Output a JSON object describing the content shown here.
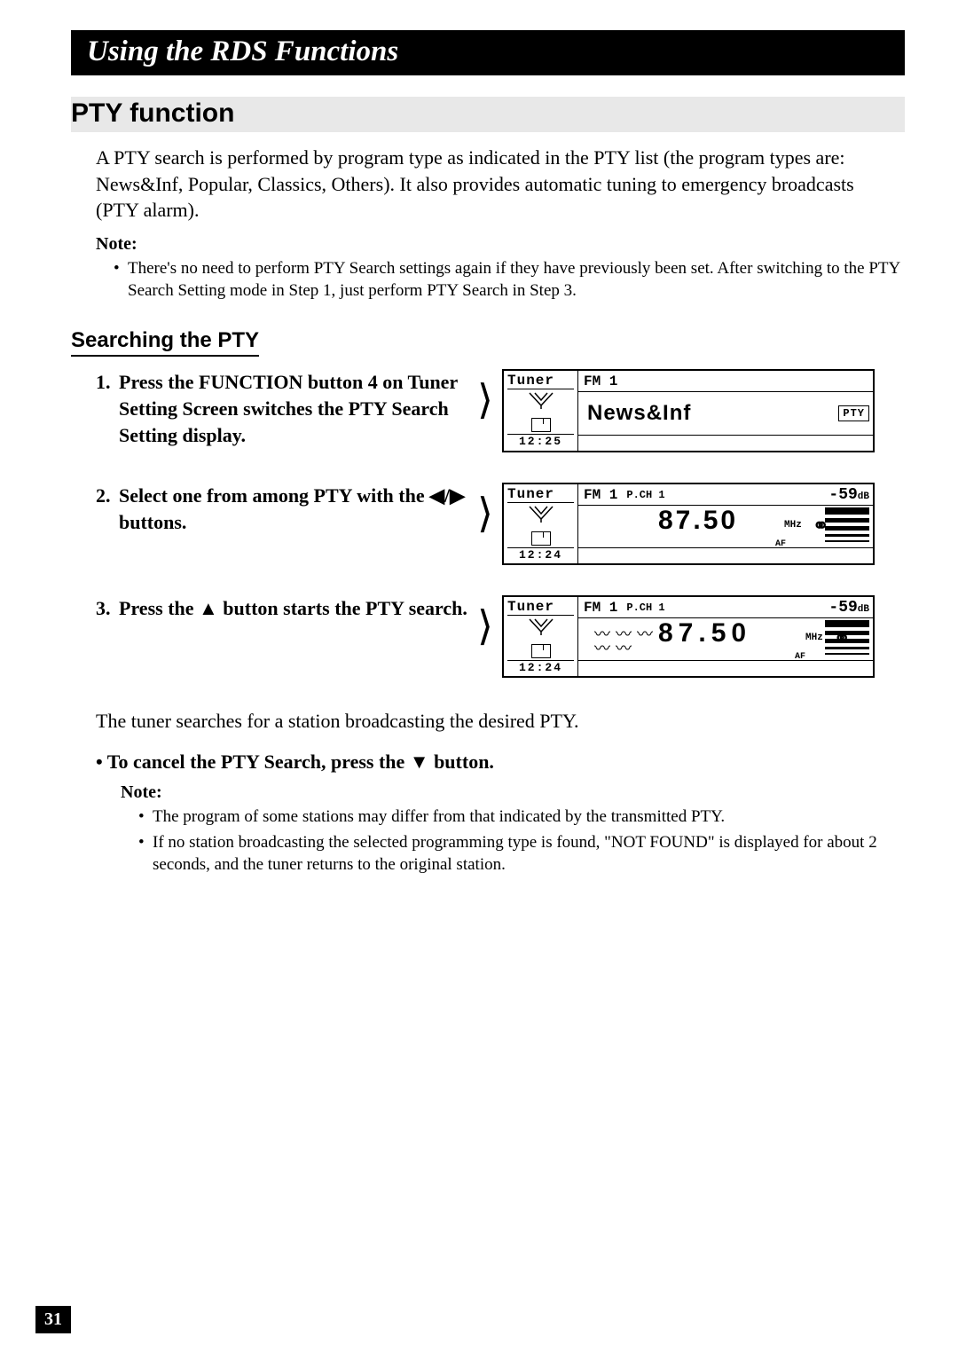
{
  "title": "Using the RDS Functions",
  "section_heading": "PTY function",
  "intro": "A PTY search is performed by program type as indicated in the PTY list (the program types are: News&Inf, Popular, Classics, Others). It also provides automatic tuning to emergency broadcasts (PTY alarm).",
  "note_label": "Note:",
  "note_top_bullets": [
    "There's no need to perform PTY Search settings again if they have previously been set. After switching to the PTY Search Setting mode in Step 1, just perform PTY Search in Step 3."
  ],
  "subheading": "Searching the PTY",
  "steps": [
    {
      "num": "1.",
      "text": "Press the FUNCTION button 4 on Tuner Setting Screen switches the PTY Search Setting display."
    },
    {
      "num": "2.",
      "text": "Select one from among PTY with the ◀/▶ buttons."
    },
    {
      "num": "3.",
      "text": "Press the ▲ button starts the PTY search."
    }
  ],
  "lcd": {
    "tuner": "Tuner",
    "fm": "FM 1",
    "pch": "P.CH 1",
    "db": "-59",
    "db_unit": "dB",
    "pty_cat": "News&Inf",
    "pty_pill": "PTY",
    "freq": "87.50",
    "mhz": "MHz",
    "af": "AF",
    "time1": "12:25",
    "time2": "12:24",
    "time3": "12:24",
    "stereo": "⚭"
  },
  "after_steps": "The tuner searches for a station broadcasting the desired PTY.",
  "cancel_line": "• To cancel the PTY Search, press the ▼ button.",
  "note_bottom_bullets": [
    "The program of some stations may differ from that indicated by the transmitted PTY.",
    "If no station broadcasting the selected programming type is found, \"NOT FOUND\" is displayed for about 2 seconds, and the tuner returns to the original station."
  ],
  "page_number": "31"
}
